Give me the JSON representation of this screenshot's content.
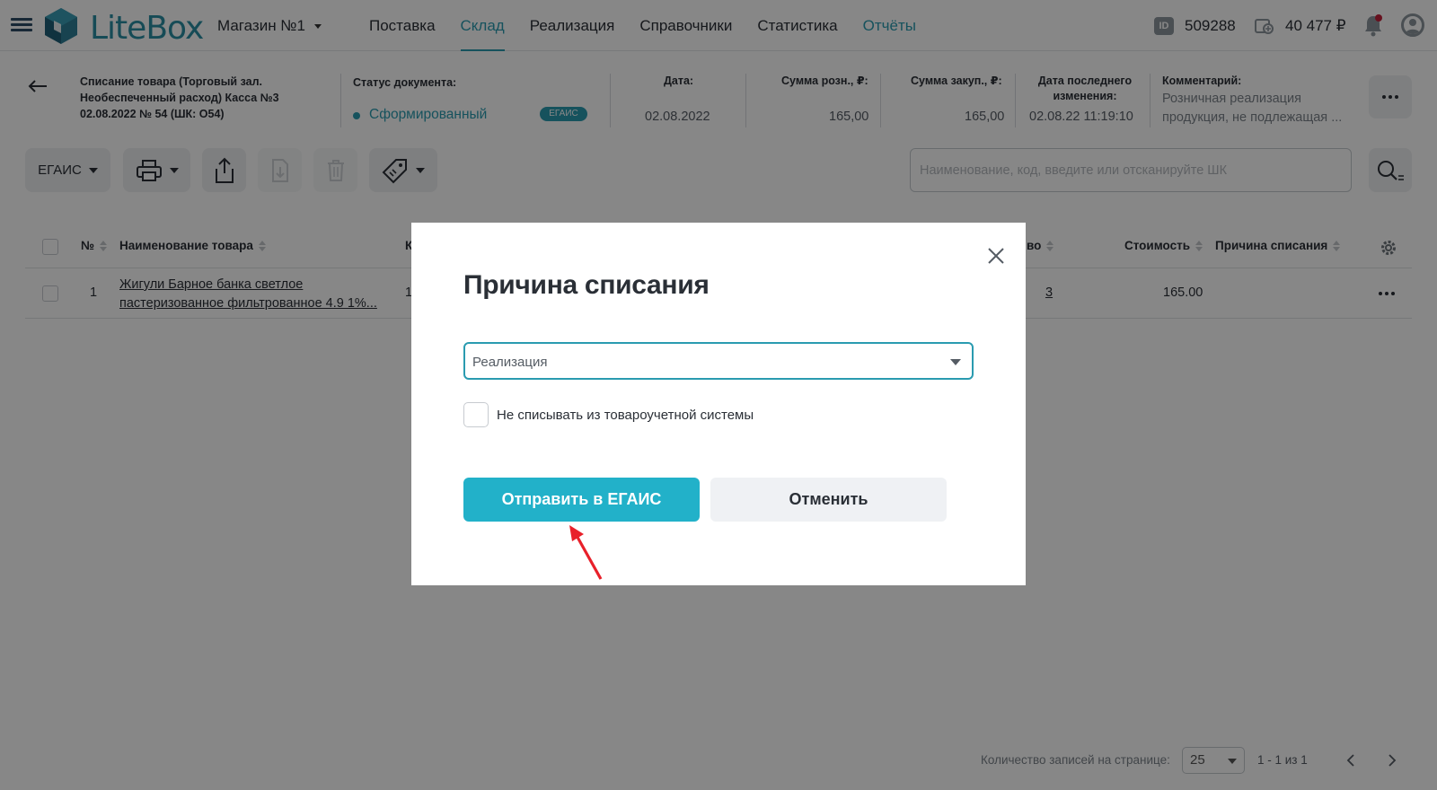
{
  "app": {
    "brand": "LiteBox",
    "store": "Магазин №1",
    "nav": [
      {
        "label": "Поставка"
      },
      {
        "label": "Склад"
      },
      {
        "label": "Реализация"
      },
      {
        "label": "Справочники"
      },
      {
        "label": "Статистика"
      },
      {
        "label": "Отчёты"
      }
    ],
    "active_nav": "Склад",
    "account_id_badge": "ID",
    "account_id": "509288",
    "balance": "40 477 ₽"
  },
  "document": {
    "title_line1": "Списание товара (Торговый зал.",
    "title_line2": "Необеспеченный расход) Касса №3",
    "title_line3": "02.08.2022 № 54 (ШК: О54)",
    "status_label": "Статус документа:",
    "status_value": "Сформированный",
    "status_badge": "ЕГАИС",
    "date_label": "Дата:",
    "date_value": "02.08.2022",
    "retail_sum_label": "Сумма розн., ₽:",
    "retail_sum_value": "165,00",
    "purchase_sum_label": "Сумма закуп., ₽:",
    "purchase_sum_value": "165,00",
    "last_change_label_1": "Дата последнего",
    "last_change_label_2": "изменения:",
    "last_change_value": "02.08.22 11:19:10",
    "comment_label": "Комментарий:",
    "comment_line1": "Розничная реализация",
    "comment_line2": "продукция, не подлежащая ..."
  },
  "toolbar": {
    "egais_label": "ЕГАИС",
    "search_placeholder": "Наименование, код, введите или отсканируйте ШК"
  },
  "table": {
    "headers": {
      "num": "№",
      "name": "Наименование товара",
      "partial_col": "К",
      "qty_tail": "во",
      "cost": "Стоимость",
      "reason": "Причина списания"
    },
    "rows": [
      {
        "num": "1",
        "name_line1": "Жигули Барное банка светлое",
        "name_line2": "пастеризованное фильтрованное 4.9 1%...",
        "partial": "1",
        "qty": "3",
        "cost": "165.00",
        "reason": ""
      }
    ]
  },
  "pagination": {
    "per_page_label": "Количество записей на странице:",
    "per_page_value": "25",
    "range": "1 - 1 из 1"
  },
  "modal": {
    "title": "Причина списания",
    "select_value": "Реализация",
    "checkbox_label": "Не списывать из товароучетной системы",
    "checkbox_checked": false,
    "primary_button": "Отправить в ЕГАИС",
    "secondary_button": "Отменить"
  },
  "colors": {
    "accent": "#2a9bb0",
    "primary_button": "#22b1c9",
    "annotation_arrow": "#e8202a"
  }
}
